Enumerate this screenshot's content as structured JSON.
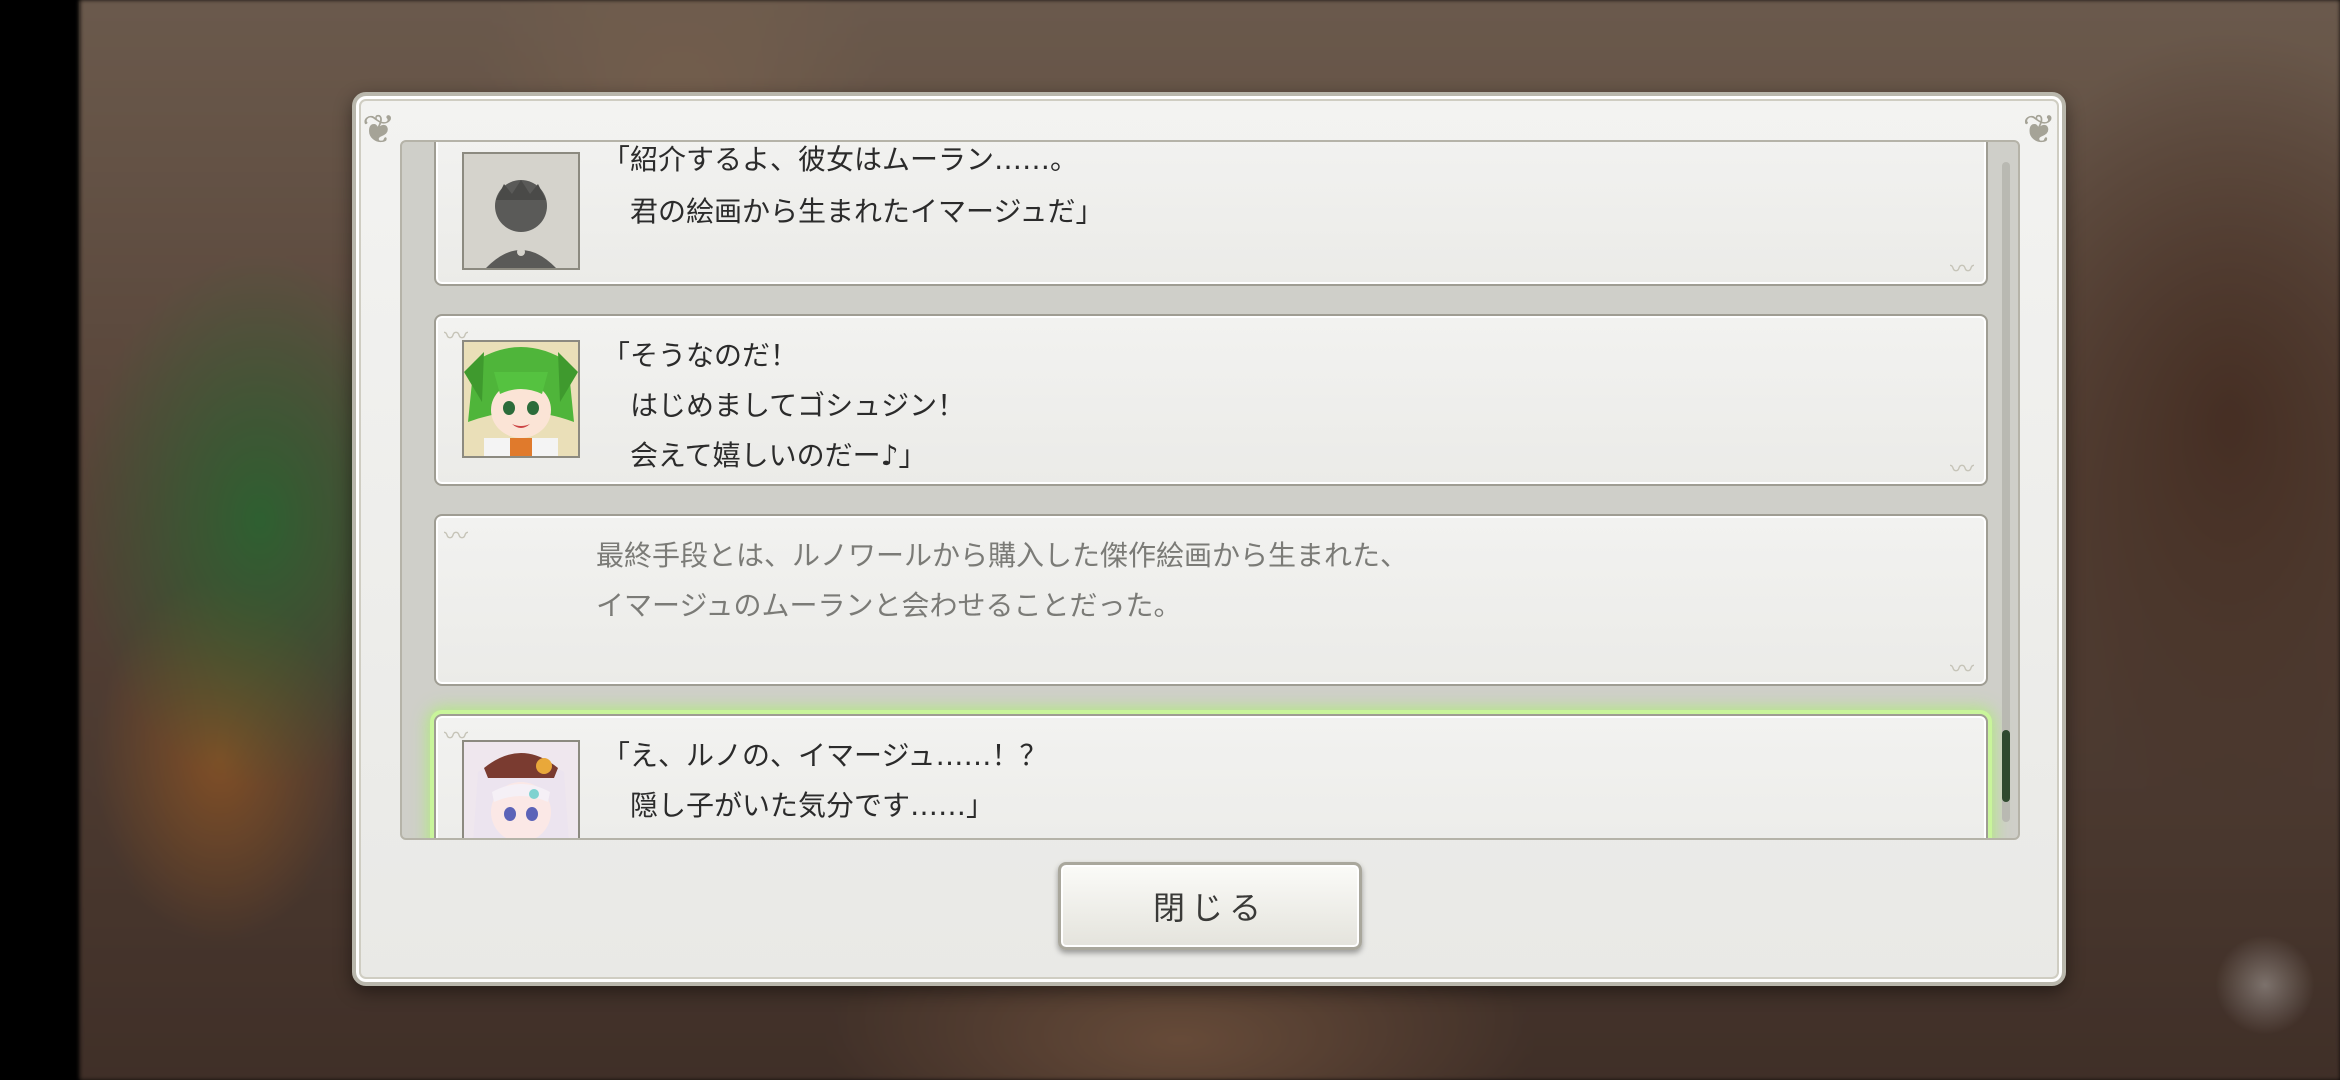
{
  "dialog": {
    "close_label": "閉じる"
  },
  "log": {
    "entries": [
      {
        "speaker_type": "character",
        "portrait_icon": "silhouette-boy-portrait",
        "lines": [
          "「紹介するよ、彼女はムーラン……。",
          "　君の絵画から生まれたイマージュだ」"
        ]
      },
      {
        "speaker_type": "character",
        "portrait_icon": "green-hair-girl-portrait",
        "lines": [
          "「そうなのだ！",
          "　はじめましてゴシュジン！",
          "　会えて嬉しいのだー♪」"
        ]
      },
      {
        "speaker_type": "narration",
        "lines": [
          "最終手段とは、ルノワールから購入した傑作絵画から生まれた、",
          "イマージュのムーランと会わせることだった。"
        ]
      },
      {
        "speaker_type": "character",
        "portrait_icon": "white-hair-girl-portrait",
        "highlighted": true,
        "lines": [
          "「え、ルノの、イマージュ……！？",
          "　隠し子がいた気分です……」"
        ]
      }
    ]
  },
  "colors": {
    "highlight": "#c9f59b",
    "scroll_thumb": "#2f4a2f",
    "panel": "#ebebe8"
  }
}
